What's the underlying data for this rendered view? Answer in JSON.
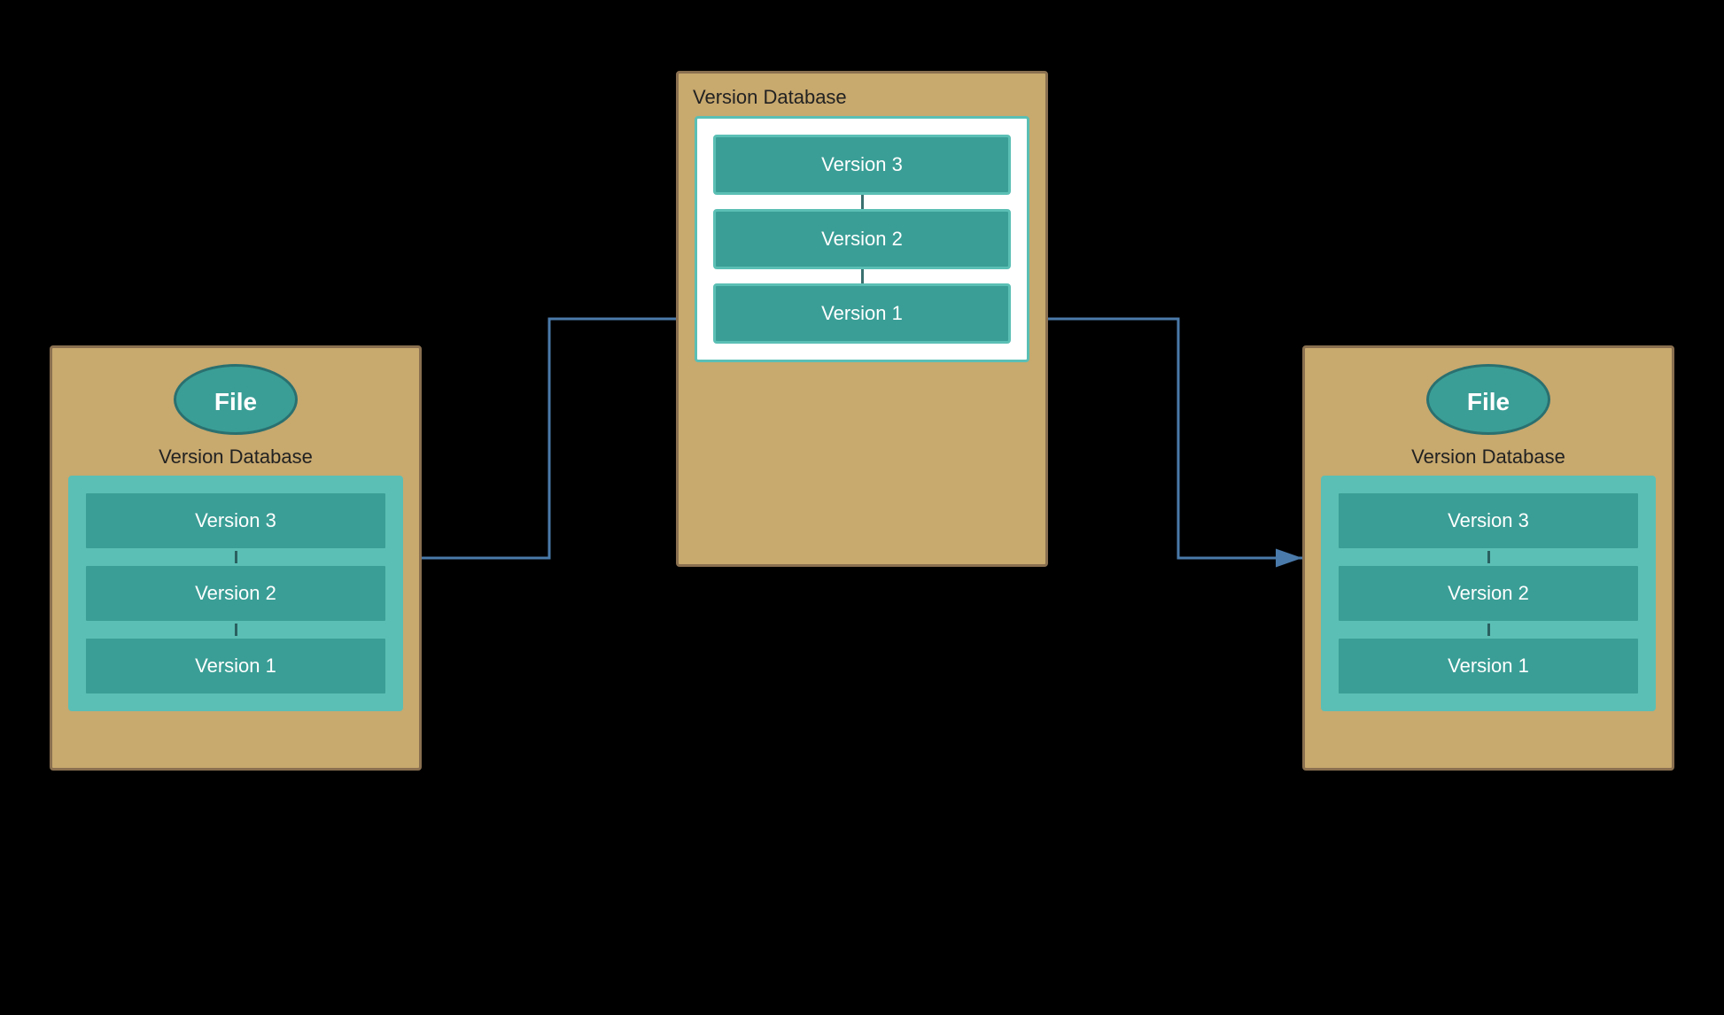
{
  "diagram": {
    "background": "#000000",
    "center_box": {
      "label": "Version Database",
      "versions": [
        "Version 3",
        "Version 2",
        "Version 1"
      ]
    },
    "left_box": {
      "label": "Version Database",
      "file_label": "File",
      "versions": [
        "Version 3",
        "Version 2",
        "Version 1"
      ]
    },
    "right_box": {
      "label": "Version Database",
      "file_label": "File",
      "versions": [
        "Version 3",
        "Version 2",
        "Version 1"
      ]
    },
    "arrows": {
      "color": "#4a7aaa",
      "left_arrow_direction": "center-to-left",
      "right_arrow_direction": "center-to-right"
    }
  }
}
